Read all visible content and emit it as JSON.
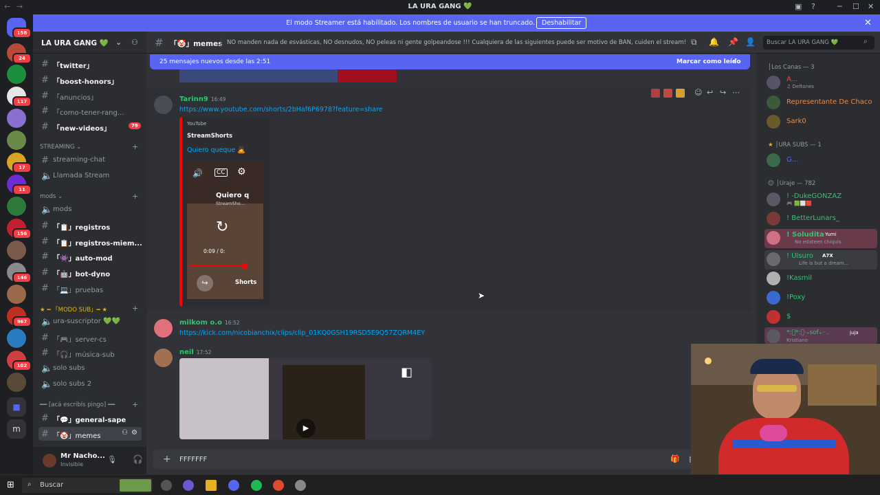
{
  "window": {
    "title": "LA URA GANG 💚"
  },
  "banner": {
    "message": "El modo Streamer está habilitado. Los nombres de usuario se han truncado.",
    "button": "Deshabilitar"
  },
  "rail": {
    "badges": [
      "158",
      "24",
      "117",
      "17",
      "11",
      "156",
      "146",
      "967",
      "102"
    ],
    "bottom_letter": "m"
  },
  "guild": {
    "name": "LA URA GANG 💚"
  },
  "channels": {
    "top": [
      {
        "label": "「twitter」",
        "unread": true
      },
      {
        "label": "「boost-honors」",
        "unread": true
      },
      {
        "label": "「anuncios」",
        "unread": false
      },
      {
        "label": "「como-tener-rang...",
        "unread": false
      },
      {
        "label": "「new-videos」",
        "unread": true,
        "badge": "79"
      }
    ],
    "cat_streaming": "STREAMING",
    "streaming": [
      "streaming-chat",
      "Llamada Stream"
    ],
    "cat_mods": "mods",
    "mods": [
      {
        "label": "mods",
        "unread": false
      },
      {
        "label": "「📋」registros",
        "unread": true
      },
      {
        "label": "「📋」registros-miem...",
        "unread": true
      },
      {
        "label": "「👾」auto-mod",
        "unread": true
      },
      {
        "label": "「🤖」bot-dyno",
        "unread": true
      },
      {
        "label": "「💻」pruebas",
        "unread": false
      }
    ],
    "cat_sub": "━ 「MODO SUB」━",
    "sub": [
      "ura-suscriptor 💚💚",
      "「🎮」server-cs",
      "「🎧」música-sub",
      "solo subs",
      "solo subs 2"
    ],
    "cat_pingo": "━━ [acá escribís pingo] ━━",
    "pingo": [
      {
        "label": "「💬」general-sape",
        "unread": true
      },
      {
        "label": "「🤡」memes",
        "active": true
      }
    ]
  },
  "user": {
    "name": "Mr Nacho...",
    "status": "Invisible"
  },
  "chat_header": {
    "channel": "「🤡」memes",
    "topic": "NO manden nada de esvásticas, NO desnudos, NO peleas ni gente golpeandose !!! Cualquiera de las siguientes puede ser motivo de BAN, cuiden el stream!"
  },
  "new_messages": {
    "text": "25 mensajes nuevos desde las 2:51",
    "mark": "Marcar como leído"
  },
  "messages": [
    {
      "author": "Tarinn9",
      "time": "16:49",
      "color": "#2dc770",
      "link": "https://www.youtube.com/shorts/2bHaf6P6978?feature=share",
      "embed": {
        "provider": "YouTube",
        "author": "StreamShorts",
        "title": "Quiero queque 🙇",
        "video_title": "Quiero q",
        "video_channel": "StreamSho...",
        "timecode": "0:09 / 0:",
        "shorts": "Shorts"
      }
    },
    {
      "author": "milkom o.o",
      "time": "16:52",
      "color": "#2dc770",
      "link": "https://kick.com/nicobianchix/clips/clip_01KQ0GSH19RSD5E9Q57ZQRM4EY"
    },
    {
      "author": "neil",
      "time": "17:52",
      "color": "#2dc770"
    }
  ],
  "composer": {
    "value": "FFFFFFF"
  },
  "search": {
    "placeholder": "Buscar LA URA GANG 💚"
  },
  "members": {
    "cat1": "│Los Canas — 3",
    "g1": [
      {
        "name": "A...",
        "sub": "♫ Deftones",
        "color": "#f23f43"
      },
      {
        "name": "Representante De Chaco",
        "color": "#f0883e"
      },
      {
        "name": "Sark0",
        "color": "#f0883e"
      }
    ],
    "cat2": "│URA SUBS — 1",
    "g2": [
      {
        "name": "G...",
        "color": "#5865f2"
      }
    ],
    "cat3": "│Uraje — 782",
    "g3": [
      {
        "name": "! -DukeGONZAZ",
        "color": "#2dc770"
      },
      {
        "name": "! BetterLunars_",
        "color": "#2dc770"
      },
      {
        "name": "! Soludita",
        "sub": "No edateen chiquis",
        "color": "#2dc770",
        "tag": "Yumi"
      },
      {
        "name": "! Ulsuro",
        "sub": "Life is but a dream...",
        "color": "#2dc770",
        "tag": "A7X"
      },
      {
        "name": "!Kasmil",
        "color": "#2dc770"
      },
      {
        "name": "!Poxy",
        "color": "#2dc770"
      },
      {
        "name": "$",
        "color": "#2dc770"
      },
      {
        "name": "*:ﾟ*:ﾟ‧₊sof₊‧·..",
        "sub": "Kristiano",
        "color": "#2dc770",
        "tag": "juja"
      }
    ]
  },
  "taskbar": {
    "search": "Buscar"
  }
}
